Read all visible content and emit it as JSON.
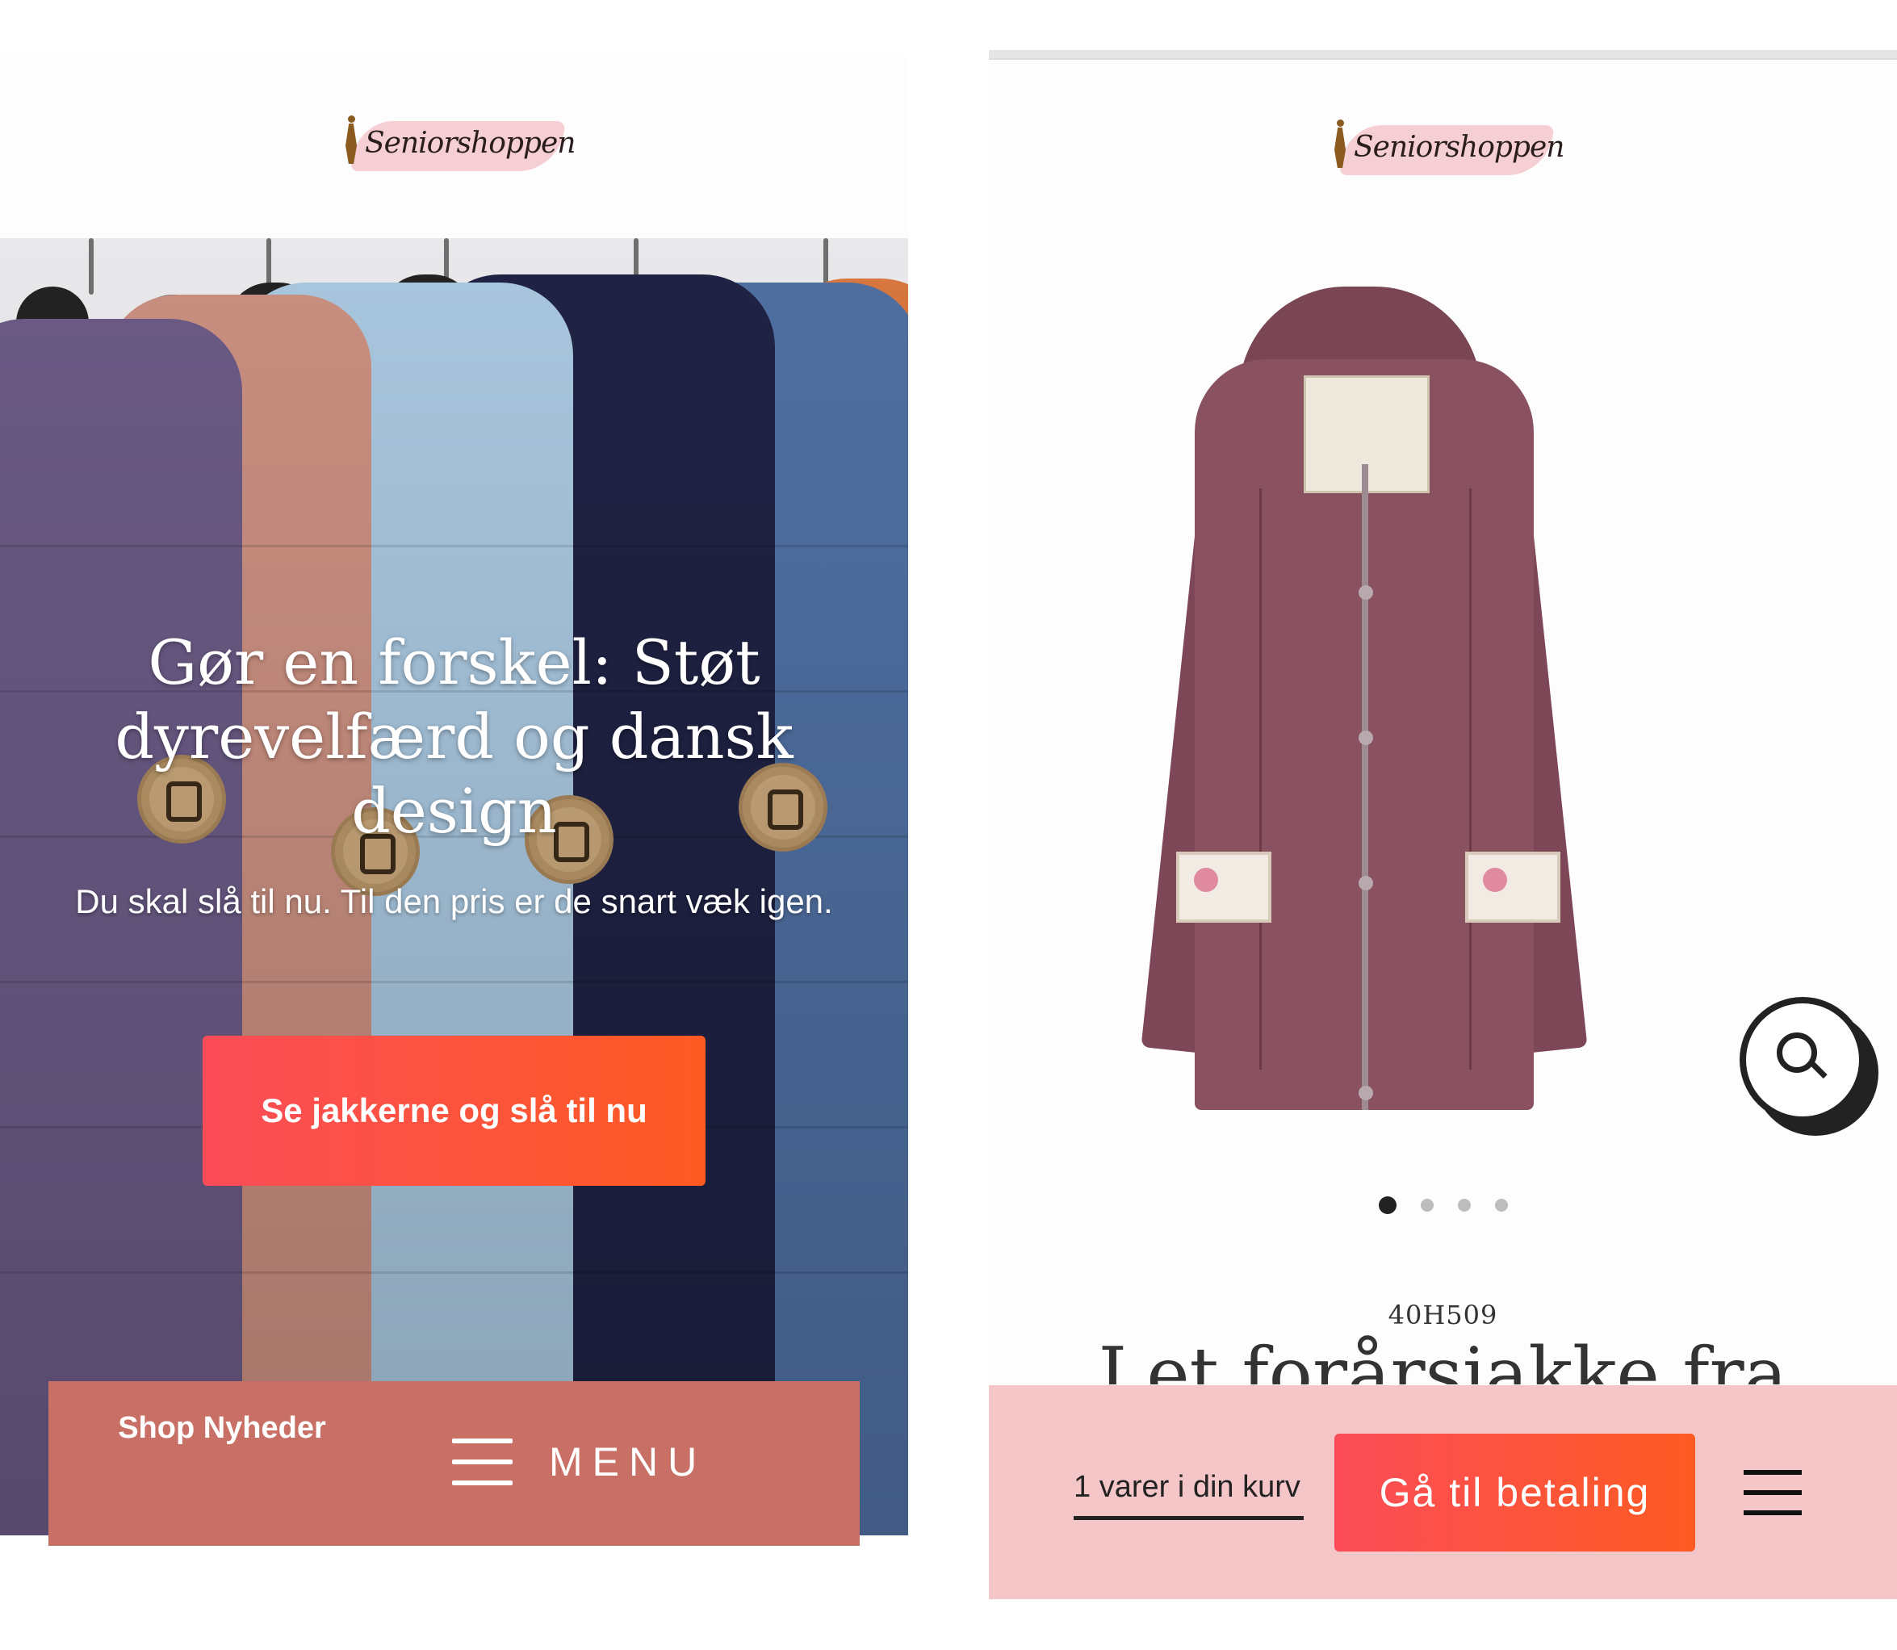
{
  "left": {
    "brand": "Seniorshoppen",
    "hero": {
      "title": "Gør en forskel: Støt dyrevelfærd og dansk design",
      "subtitle": "Du skal slå til nu. Til den pris er de snart væk igen.",
      "cta_label": "Se jakkerne og slå til nu"
    },
    "bottom_bar": {
      "shop_news": "Shop Nyheder",
      "menu_label": "MENU",
      "bar_color": "#c97066"
    }
  },
  "right": {
    "brand": "Seniorshoppen",
    "product": {
      "sku": "40H509",
      "title_partial": "Let forårsjakke fra",
      "gallery_dots": 4,
      "active_dot": 1
    },
    "bottom_bar": {
      "cart_label": "1 varer i din kurv",
      "checkout_label": "Gå til betaling",
      "bar_color": "#f5c6c8"
    }
  },
  "colors": {
    "cta_gradient_start": "#fb4c58",
    "cta_gradient_end": "#fd5a22",
    "logo_brush": "#f4c7cd"
  },
  "icons": {
    "menu": "hamburger-icon",
    "zoom": "search-icon"
  }
}
